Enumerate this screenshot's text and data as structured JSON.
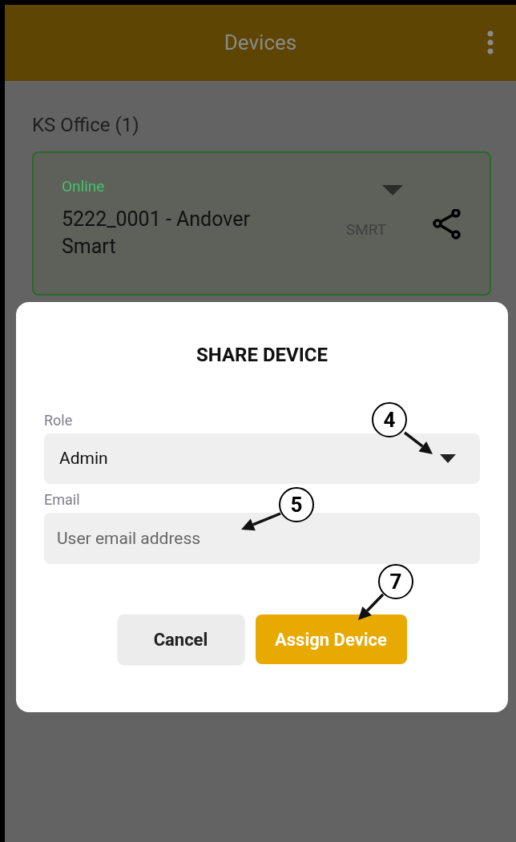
{
  "app_bar": {
    "title": "Devices"
  },
  "group": {
    "title": "KS Office (1)"
  },
  "device": {
    "status": "Online",
    "name": "5222_0001 - Andover Smart",
    "type": "SMRT"
  },
  "dialog": {
    "title": "SHARE DEVICE",
    "fields": [
      {
        "kind": "select",
        "label": "Role",
        "value": "Admin"
      },
      {
        "kind": "text",
        "label": "Email",
        "placeholder": "User email address"
      }
    ],
    "buttons": [
      {
        "kind": "secondary",
        "label": "Cancel"
      },
      {
        "kind": "primary",
        "label": "Assign Device"
      }
    ]
  },
  "callouts": [
    {
      "label": "4"
    },
    {
      "label": "5"
    },
    {
      "label": "7"
    }
  ]
}
